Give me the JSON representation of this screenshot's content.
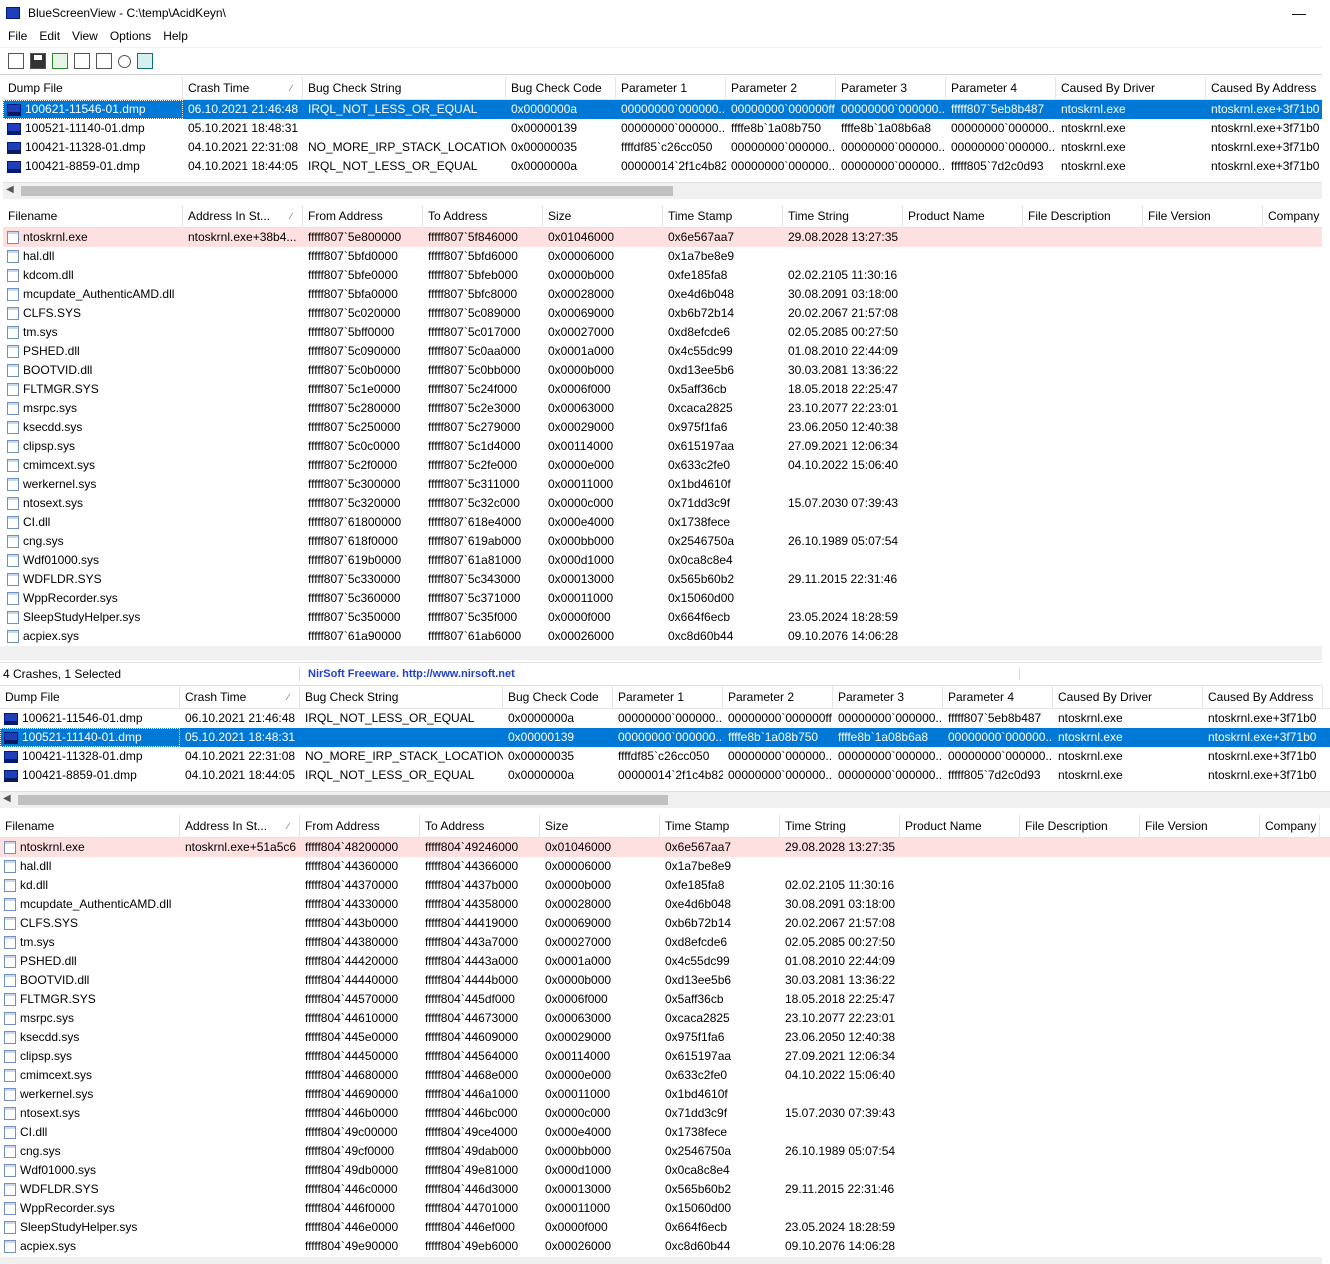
{
  "app": {
    "title": "BlueScreenView  -  C:\\temp\\AcidKeyn\\",
    "minimize": "—"
  },
  "menu": [
    "File",
    "Edit",
    "View",
    "Options",
    "Help"
  ],
  "toolbar": [
    "properties-icon",
    "save-icon",
    "refresh-icon",
    "copy-icon",
    "html-report-icon",
    "find-icon",
    "exit-icon"
  ],
  "crash_columns": [
    "Dump File",
    "Crash Time",
    "Bug Check String",
    "Bug Check Code",
    "Parameter 1",
    "Parameter 2",
    "Parameter 3",
    "Parameter 4",
    "Caused By Driver",
    "Caused By Address"
  ],
  "module_columns": [
    "Filename",
    "Address In St...",
    "From Address",
    "To Address",
    "Size",
    "Time Stamp",
    "Time String",
    "Product Name",
    "File Description",
    "File Version",
    "Company"
  ],
  "top_crashes": [
    [
      "100621-11546-01.dmp",
      "06.10.2021 21:46:48",
      "IRQL_NOT_LESS_OR_EQUAL",
      "0x0000000a",
      "00000000`000000...",
      "00000000`000000ff",
      "00000000`000000...",
      "fffff807`5eb8b487",
      "ntoskrnl.exe",
      "ntoskrnl.exe+3f71b0"
    ],
    [
      "100521-11140-01.dmp",
      "05.10.2021 18:48:31",
      "",
      "0x00000139",
      "00000000`000000...",
      "ffffe8b`1a08b750",
      "ffffe8b`1a08b6a8",
      "00000000`000000...",
      "ntoskrnl.exe",
      "ntoskrnl.exe+3f71b0"
    ],
    [
      "100421-11328-01.dmp",
      "04.10.2021 22:31:08",
      "NO_MORE_IRP_STACK_LOCATIONS",
      "0x00000035",
      "ffffdf85`c26cc050",
      "00000000`000000...",
      "00000000`000000...",
      "00000000`000000...",
      "ntoskrnl.exe",
      "ntoskrnl.exe+3f71b0"
    ],
    [
      "100421-8859-01.dmp",
      "04.10.2021 18:44:05",
      "IRQL_NOT_LESS_OR_EQUAL",
      "0x0000000a",
      "00000014`2f1c4b82",
      "00000000`000000...",
      "00000000`000000...",
      "fffff805`7d2c0d93",
      "ntoskrnl.exe",
      "ntoskrnl.exe+3f71b0"
    ]
  ],
  "top_modules": [
    [
      "ntoskrnl.exe",
      "ntoskrnl.exe+38b4...",
      "fffff807`5e800000",
      "fffff807`5f846000",
      "0x01046000",
      "0x6e567aa7",
      "29.08.2028 13:27:35",
      "",
      "",
      "",
      ""
    ],
    [
      "hal.dll",
      "",
      "fffff807`5bfd0000",
      "fffff807`5bfd6000",
      "0x00006000",
      "0x1a7be8e9",
      "",
      "",
      "",
      "",
      ""
    ],
    [
      "kdcom.dll",
      "",
      "fffff807`5bfe0000",
      "fffff807`5bfeb000",
      "0x0000b000",
      "0xfe185fa8",
      "02.02.2105 11:30:16",
      "",
      "",
      "",
      ""
    ],
    [
      "mcupdate_AuthenticAMD.dll",
      "",
      "fffff807`5bfa0000",
      "fffff807`5bfc8000",
      "0x00028000",
      "0xe4d6b048",
      "30.08.2091 03:18:00",
      "",
      "",
      "",
      ""
    ],
    [
      "CLFS.SYS",
      "",
      "fffff807`5c020000",
      "fffff807`5c089000",
      "0x00069000",
      "0xb6b72b14",
      "20.02.2067 21:57:08",
      "",
      "",
      "",
      ""
    ],
    [
      "tm.sys",
      "",
      "fffff807`5bff0000",
      "fffff807`5c017000",
      "0x00027000",
      "0xd8efcde6",
      "02.05.2085 00:27:50",
      "",
      "",
      "",
      ""
    ],
    [
      "PSHED.dll",
      "",
      "fffff807`5c090000",
      "fffff807`5c0aa000",
      "0x0001a000",
      "0x4c55dc99",
      "01.08.2010 22:44:09",
      "",
      "",
      "",
      ""
    ],
    [
      "BOOTVID.dll",
      "",
      "fffff807`5c0b0000",
      "fffff807`5c0bb000",
      "0x0000b000",
      "0xd13ee5b6",
      "30.03.2081 13:36:22",
      "",
      "",
      "",
      ""
    ],
    [
      "FLTMGR.SYS",
      "",
      "fffff807`5c1e0000",
      "fffff807`5c24f000",
      "0x0006f000",
      "0x5aff36cb",
      "18.05.2018 22:25:47",
      "",
      "",
      "",
      ""
    ],
    [
      "msrpc.sys",
      "",
      "fffff807`5c280000",
      "fffff807`5c2e3000",
      "0x00063000",
      "0xcaca2825",
      "23.10.2077 22:23:01",
      "",
      "",
      "",
      ""
    ],
    [
      "ksecdd.sys",
      "",
      "fffff807`5c250000",
      "fffff807`5c279000",
      "0x00029000",
      "0x975f1fa6",
      "23.06.2050 12:40:38",
      "",
      "",
      "",
      ""
    ],
    [
      "clipsp.sys",
      "",
      "fffff807`5c0c0000",
      "fffff807`5c1d4000",
      "0x00114000",
      "0x615197aa",
      "27.09.2021 12:06:34",
      "",
      "",
      "",
      ""
    ],
    [
      "cmimcext.sys",
      "",
      "fffff807`5c2f0000",
      "fffff807`5c2fe000",
      "0x0000e000",
      "0x633c2fe0",
      "04.10.2022 15:06:40",
      "",
      "",
      "",
      ""
    ],
    [
      "werkernel.sys",
      "",
      "fffff807`5c300000",
      "fffff807`5c311000",
      "0x00011000",
      "0x1bd4610f",
      "",
      "",
      "",
      "",
      ""
    ],
    [
      "ntosext.sys",
      "",
      "fffff807`5c320000",
      "fffff807`5c32c000",
      "0x0000c000",
      "0x71dd3c9f",
      "15.07.2030 07:39:43",
      "",
      "",
      "",
      ""
    ],
    [
      "CI.dll",
      "",
      "fffff807`61800000",
      "fffff807`618e4000",
      "0x000e4000",
      "0x1738fece",
      "",
      "",
      "",
      "",
      ""
    ],
    [
      "cng.sys",
      "",
      "fffff807`618f0000",
      "fffff807`619ab000",
      "0x000bb000",
      "0x2546750a",
      "26.10.1989 05:07:54",
      "",
      "",
      "",
      ""
    ],
    [
      "Wdf01000.sys",
      "",
      "fffff807`619b0000",
      "fffff807`61a81000",
      "0x000d1000",
      "0x0ca8c8e4",
      "",
      "",
      "",
      "",
      ""
    ],
    [
      "WDFLDR.SYS",
      "",
      "fffff807`5c330000",
      "fffff807`5c343000",
      "0x00013000",
      "0x565b60b2",
      "29.11.2015 22:31:46",
      "",
      "",
      "",
      ""
    ],
    [
      "WppRecorder.sys",
      "",
      "fffff807`5c360000",
      "fffff807`5c371000",
      "0x00011000",
      "0x15060d00",
      "",
      "",
      "",
      "",
      ""
    ],
    [
      "SleepStudyHelper.sys",
      "",
      "fffff807`5c350000",
      "fffff807`5c35f000",
      "0x0000f000",
      "0x664f6ecb",
      "23.05.2024 18:28:59",
      "",
      "",
      "",
      ""
    ],
    [
      "acpiex.sys",
      "",
      "fffff807`61a90000",
      "fffff807`61ab6000",
      "0x00026000",
      "0xc8d60b44",
      "09.10.2076 14:06:28",
      "",
      "",
      "",
      ""
    ]
  ],
  "status": {
    "count": "4 Crashes, 1 Selected",
    "credit": "NirSoft Freeware.  http://www.nirsoft.net"
  },
  "bottom_crashes": [
    [
      "100621-11546-01.dmp",
      "06.10.2021 21:46:48",
      "IRQL_NOT_LESS_OR_EQUAL",
      "0x0000000a",
      "00000000`000000...",
      "00000000`000000ff",
      "00000000`000000...",
      "fffff807`5eb8b487",
      "ntoskrnl.exe",
      "ntoskrnl.exe+3f71b0"
    ],
    [
      "100521-11140-01.dmp",
      "05.10.2021 18:48:31",
      "",
      "0x00000139",
      "00000000`000000...",
      "ffffe8b`1a08b750",
      "ffffe8b`1a08b6a8",
      "00000000`000000...",
      "ntoskrnl.exe",
      "ntoskrnl.exe+3f71b0"
    ],
    [
      "100421-11328-01.dmp",
      "04.10.2021 22:31:08",
      "NO_MORE_IRP_STACK_LOCATIONS",
      "0x00000035",
      "ffffdf85`c26cc050",
      "00000000`000000...",
      "00000000`000000...",
      "00000000`000000...",
      "ntoskrnl.exe",
      "ntoskrnl.exe+3f71b0"
    ],
    [
      "100421-8859-01.dmp",
      "04.10.2021 18:44:05",
      "IRQL_NOT_LESS_OR_EQUAL",
      "0x0000000a",
      "00000014`2f1c4b82",
      "00000000`000000...",
      "00000000`000000...",
      "fffff805`7d2c0d93",
      "ntoskrnl.exe",
      "ntoskrnl.exe+3f71b0"
    ]
  ],
  "bottom_modules": [
    [
      "ntoskrnl.exe",
      "ntoskrnl.exe+51a5c6",
      "fffff804`48200000",
      "fffff804`49246000",
      "0x01046000",
      "0x6e567aa7",
      "29.08.2028 13:27:35",
      "",
      "",
      "",
      ""
    ],
    [
      "hal.dll",
      "",
      "fffff804`44360000",
      "fffff804`44366000",
      "0x00006000",
      "0x1a7be8e9",
      "",
      "",
      "",
      "",
      ""
    ],
    [
      "kd.dll",
      "",
      "fffff804`44370000",
      "fffff804`4437b000",
      "0x0000b000",
      "0xfe185fa8",
      "02.02.2105 11:30:16",
      "",
      "",
      "",
      ""
    ],
    [
      "mcupdate_AuthenticAMD.dll",
      "",
      "fffff804`44330000",
      "fffff804`44358000",
      "0x00028000",
      "0xe4d6b048",
      "30.08.2091 03:18:00",
      "",
      "",
      "",
      ""
    ],
    [
      "CLFS.SYS",
      "",
      "fffff804`443b0000",
      "fffff804`44419000",
      "0x00069000",
      "0xb6b72b14",
      "20.02.2067 21:57:08",
      "",
      "",
      "",
      ""
    ],
    [
      "tm.sys",
      "",
      "fffff804`44380000",
      "fffff804`443a7000",
      "0x00027000",
      "0xd8efcde6",
      "02.05.2085 00:27:50",
      "",
      "",
      "",
      ""
    ],
    [
      "PSHED.dll",
      "",
      "fffff804`44420000",
      "fffff804`4443a000",
      "0x0001a000",
      "0x4c55dc99",
      "01.08.2010 22:44:09",
      "",
      "",
      "",
      ""
    ],
    [
      "BOOTVID.dll",
      "",
      "fffff804`44440000",
      "fffff804`4444b000",
      "0x0000b000",
      "0xd13ee5b6",
      "30.03.2081 13:36:22",
      "",
      "",
      "",
      ""
    ],
    [
      "FLTMGR.SYS",
      "",
      "fffff804`44570000",
      "fffff804`445df000",
      "0x0006f000",
      "0x5aff36cb",
      "18.05.2018 22:25:47",
      "",
      "",
      "",
      ""
    ],
    [
      "msrpc.sys",
      "",
      "fffff804`44610000",
      "fffff804`44673000",
      "0x00063000",
      "0xcaca2825",
      "23.10.2077 22:23:01",
      "",
      "",
      "",
      ""
    ],
    [
      "ksecdd.sys",
      "",
      "fffff804`445e0000",
      "fffff804`44609000",
      "0x00029000",
      "0x975f1fa6",
      "23.06.2050 12:40:38",
      "",
      "",
      "",
      ""
    ],
    [
      "clipsp.sys",
      "",
      "fffff804`44450000",
      "fffff804`44564000",
      "0x00114000",
      "0x615197aa",
      "27.09.2021 12:06:34",
      "",
      "",
      "",
      ""
    ],
    [
      "cmimcext.sys",
      "",
      "fffff804`44680000",
      "fffff804`4468e000",
      "0x0000e000",
      "0x633c2fe0",
      "04.10.2022 15:06:40",
      "",
      "",
      "",
      ""
    ],
    [
      "werkernel.sys",
      "",
      "fffff804`44690000",
      "fffff804`446a1000",
      "0x00011000",
      "0x1bd4610f",
      "",
      "",
      "",
      "",
      ""
    ],
    [
      "ntosext.sys",
      "",
      "fffff804`446b0000",
      "fffff804`446bc000",
      "0x0000c000",
      "0x71dd3c9f",
      "15.07.2030 07:39:43",
      "",
      "",
      "",
      ""
    ],
    [
      "CI.dll",
      "",
      "fffff804`49c00000",
      "fffff804`49ce4000",
      "0x000e4000",
      "0x1738fece",
      "",
      "",
      "",
      "",
      ""
    ],
    [
      "cng.sys",
      "",
      "fffff804`49cf0000",
      "fffff804`49dab000",
      "0x000bb000",
      "0x2546750a",
      "26.10.1989 05:07:54",
      "",
      "",
      "",
      ""
    ],
    [
      "Wdf01000.sys",
      "",
      "fffff804`49db0000",
      "fffff804`49e81000",
      "0x000d1000",
      "0x0ca8c8e4",
      "",
      "",
      "",
      "",
      ""
    ],
    [
      "WDFLDR.SYS",
      "",
      "fffff804`446c0000",
      "fffff804`446d3000",
      "0x00013000",
      "0x565b60b2",
      "29.11.2015 22:31:46",
      "",
      "",
      "",
      ""
    ],
    [
      "WppRecorder.sys",
      "",
      "fffff804`446f0000",
      "fffff804`44701000",
      "0x00011000",
      "0x15060d00",
      "",
      "",
      "",
      "",
      ""
    ],
    [
      "SleepStudyHelper.sys",
      "",
      "fffff804`446e0000",
      "fffff804`446ef000",
      "0x0000f000",
      "0x664f6ecb",
      "23.05.2024 18:28:59",
      "",
      "",
      "",
      ""
    ],
    [
      "acpiex.sys",
      "",
      "fffff804`49e90000",
      "fffff804`49eb6000",
      "0x00026000",
      "0xc8d60b44",
      "09.10.2076 14:06:28",
      "",
      "",
      "",
      ""
    ]
  ],
  "colors": {
    "selection": "#0078d7",
    "highlight_row": "#ffe0e0",
    "credit_link": "#2040d0"
  }
}
